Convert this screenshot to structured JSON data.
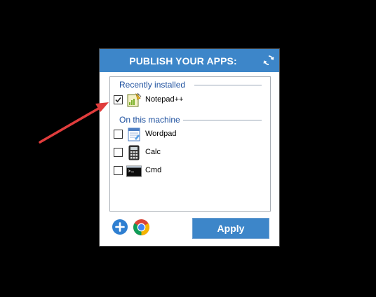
{
  "panel": {
    "title": "PUBLISH YOUR APPS:",
    "refresh_icon": "refresh-icon",
    "accent_color": "#3d86c9"
  },
  "groups": [
    {
      "label": "Recently installed",
      "apps": [
        {
          "name": "Notepad++",
          "checked": true,
          "icon": "notepad-plus-plus-icon"
        }
      ]
    },
    {
      "label": "On this machine",
      "apps": [
        {
          "name": "Wordpad",
          "checked": false,
          "icon": "wordpad-icon"
        },
        {
          "name": "Calc",
          "checked": false,
          "icon": "calculator-icon"
        },
        {
          "name": "Cmd",
          "checked": false,
          "icon": "command-prompt-icon"
        }
      ]
    }
  ],
  "footer": {
    "add_icon": "add-icon",
    "browser_icon": "chrome-icon",
    "apply_label": "Apply"
  },
  "annotation": {
    "arrow_color": "#e03c3c"
  }
}
